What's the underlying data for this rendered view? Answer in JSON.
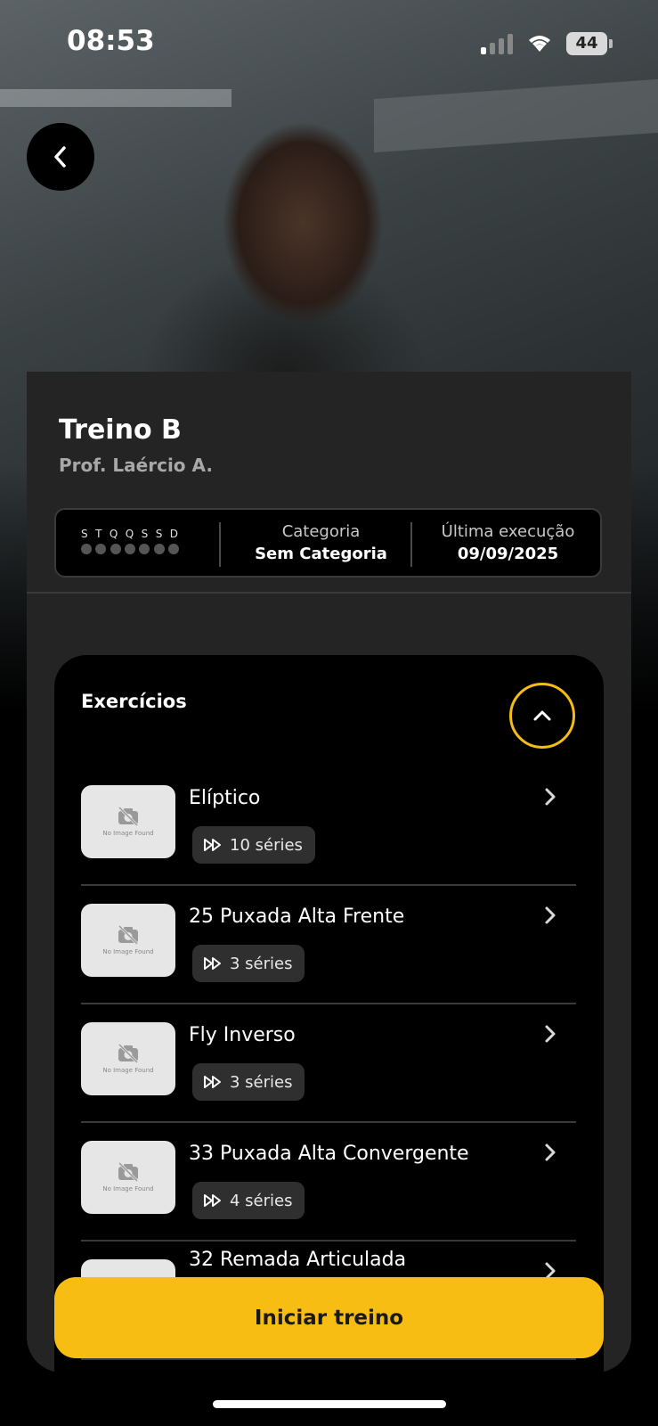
{
  "status_bar": {
    "time": "08:53",
    "battery": "44"
  },
  "workout": {
    "title": "Treino B",
    "trainer": "Prof. Laércio A.",
    "days": [
      "S",
      "T",
      "Q",
      "Q",
      "S",
      "S",
      "D"
    ],
    "category_label": "Categoria",
    "category_value": "Sem Categoria",
    "last_exec_label": "Última execução",
    "last_exec_value": "09/09/2025"
  },
  "exercises": {
    "heading": "Exercícios",
    "no_image_text": "No Image Found",
    "items": [
      {
        "name": "Elíptico",
        "series": "10 séries"
      },
      {
        "name": "25 Puxada Alta Frente",
        "series": "3 séries"
      },
      {
        "name": "Fly Inverso",
        "series": "3 séries"
      },
      {
        "name": "33 Puxada Alta Convergente",
        "series": "4 séries"
      },
      {
        "name": "32 Remada Articulada",
        "series": ""
      }
    ]
  },
  "actions": {
    "start_label": "Iniciar treino"
  },
  "colors": {
    "accent": "#f8bd12",
    "card": "#242424",
    "background": "#000000"
  }
}
